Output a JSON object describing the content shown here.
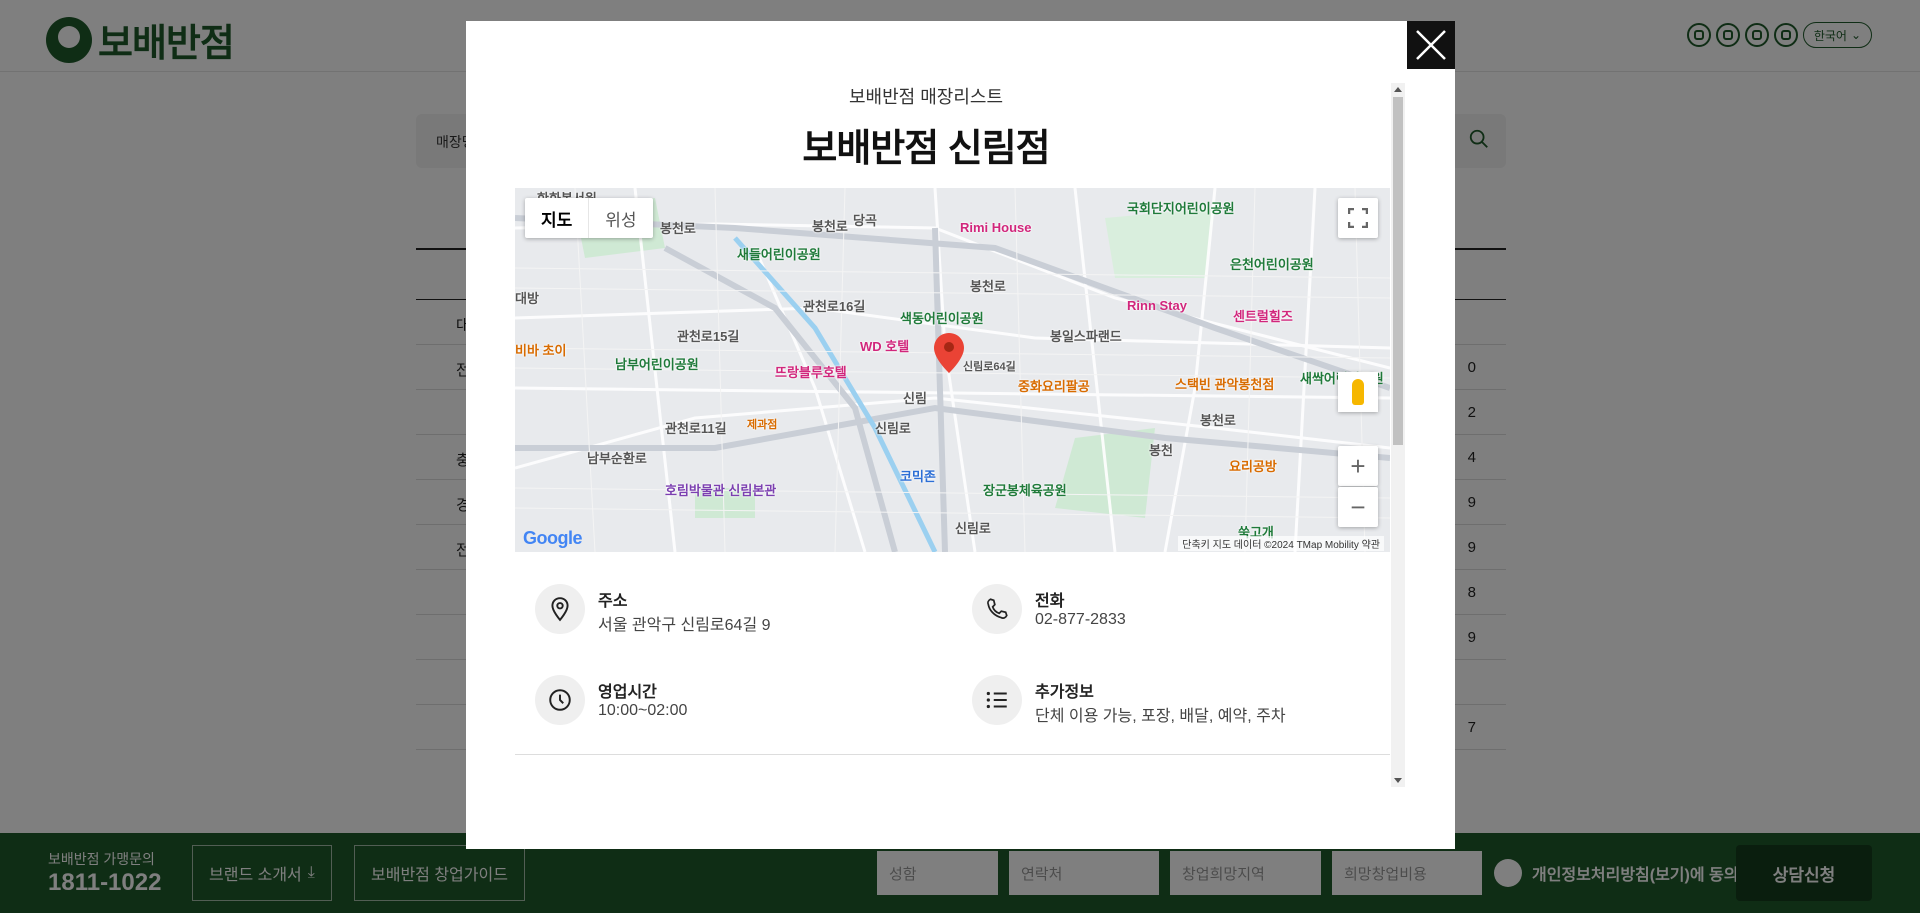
{
  "header": {
    "logo_text": "보배반점",
    "sns_icons": [
      "instagram-icon",
      "tiktok-icon",
      "youtube-icon",
      "blog-icon"
    ],
    "language": "한국어"
  },
  "background": {
    "search_label": "매장명",
    "rows_left": [
      "대",
      "전",
      "",
      "충",
      "경",
      "전",
      "",
      "",
      "",
      ""
    ],
    "rows_right": [
      "",
      "0",
      "2",
      "4",
      "9",
      "9",
      "8",
      "9",
      "",
      "7"
    ]
  },
  "modal": {
    "subtitle": "보배반점 매장리스트",
    "title": "보배반점 신림점",
    "close_icon": "close-icon",
    "map": {
      "type_map": "지도",
      "type_satellite": "위성",
      "google": "Google",
      "attribution": "단축키   지도 데이터 ©2024 TMap Mobility   약관",
      "labels": {
        "hanwha": "한화봉서원",
        "bongcheon1": "봉천로",
        "bongcheon2": "봉천로",
        "bongcheon3": "봉천로",
        "bongcheon4": "봉천로",
        "dangok": "당곡",
        "rimi": "Rimi House",
        "gukhoe": "국회단지어린이공원",
        "euncheon": "은천어린이공원",
        "saedeul": "새들어린이공원",
        "daebang": "대방",
        "gwancheon16": "관천로16길",
        "gwancheon15": "관천로15길",
        "gwancheon11": "관천로11길",
        "saekdong": "색동어린이공원",
        "bongil": "봉일스파랜드",
        "rinn": "Rinn Stay",
        "central": "센트럴힐즈",
        "choi": "비바 초이",
        "nambu": "남부어린이공원",
        "wd": "WD 호텔",
        "tteurang": "뜨랑블루호텔",
        "sillimro64": "신림로64길",
        "junghwa": "중화요리팔공",
        "starbucks": "스택빈 관악봉천점",
        "saessak": "새싹어린이공원",
        "sillim_st": "신림",
        "bongcheon_st": "봉천",
        "jegwa": "제과점",
        "sillimro1": "신림로",
        "sillimro2": "신림로",
        "nambusunhwan": "남부순환로",
        "komi": "코믹존",
        "horim": "호림박물관 신림본관",
        "janggun": "장군봉체육공원",
        "yori": "요리공방",
        "ssuk": "쑥고개"
      }
    },
    "info": {
      "address_label": "주소",
      "address_value": "서울 관악구 신림로64길 9",
      "phone_label": "전화",
      "phone_value": "02-877-2833",
      "hours_label": "영업시간",
      "hours_value": "10:00~02:00",
      "extra_label": "추가정보",
      "extra_value": "단체 이용 가능, 포장, 배달, 예약, 주차"
    }
  },
  "bottom_bar": {
    "inquiry_label": "보배반점 가맹문의",
    "phone": "1811-1022",
    "brand_intro": "브랜드 소개서",
    "startup_guide": "보배반점 창업가이드",
    "name_placeholder": "성함",
    "contact_placeholder": "연락처",
    "region_placeholder": "창업희망지역",
    "budget_placeholder": "희망창업비용",
    "agree_text": "개인정보처리방침(보기)에 동의",
    "submit": "상담신청"
  }
}
